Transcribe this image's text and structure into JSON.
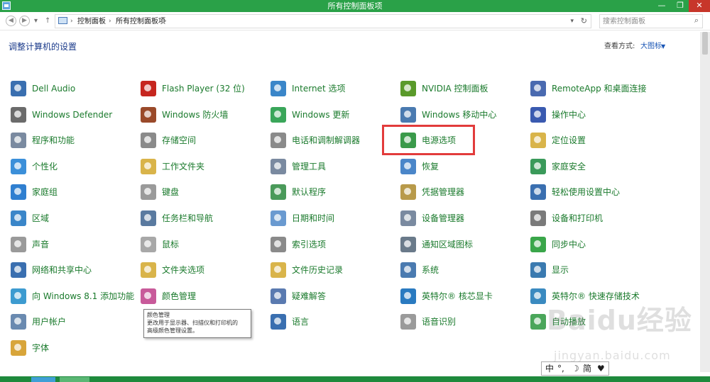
{
  "window": {
    "title": "所有控制面板项"
  },
  "nav": {
    "breadcrumb": [
      "控制面板",
      "所有控制面板项"
    ],
    "search_placeholder": "搜索控制面板"
  },
  "header": {
    "title": "调整计算机的设置",
    "view_by_label": "查看方式:",
    "view_by_value": "大图标"
  },
  "items": [
    {
      "label": "Dell Audio",
      "icon": "audio-icon",
      "color": "#3a6fb0"
    },
    {
      "label": "Windows Defender",
      "icon": "wall-icon",
      "color": "#6b6b6b"
    },
    {
      "label": "程序和功能",
      "icon": "programs-icon",
      "color": "#7a8aa0"
    },
    {
      "label": "个性化",
      "icon": "personalize-icon",
      "color": "#3b8fd9"
    },
    {
      "label": "家庭组",
      "icon": "homegroup-icon",
      "color": "#2f7fd0"
    },
    {
      "label": "区域",
      "icon": "globe-icon",
      "color": "#3a86c9"
    },
    {
      "label": "声音",
      "icon": "speaker-icon",
      "color": "#9a9a9a"
    },
    {
      "label": "网络和共享中心",
      "icon": "network-icon",
      "color": "#3a6fb0"
    },
    {
      "label": "向 Windows 8.1 添加功能",
      "icon": "add-features-icon",
      "color": "#3d9bd0"
    },
    {
      "label": "用户帐户",
      "icon": "users-icon",
      "color": "#6a8ab0"
    },
    {
      "label": "字体",
      "icon": "fonts-icon",
      "color": "#d8a53a"
    },
    {
      "label": "Flash Player (32 位)",
      "icon": "flash-icon",
      "color": "#c6261f"
    },
    {
      "label": "Windows 防火墙",
      "icon": "firewall-icon",
      "color": "#9a4a2a"
    },
    {
      "label": "存储空间",
      "icon": "storage-icon",
      "color": "#8a8a8a"
    },
    {
      "label": "工作文件夹",
      "icon": "work-folder-icon",
      "color": "#d9b44a"
    },
    {
      "label": "键盘",
      "icon": "keyboard-icon",
      "color": "#9a9a9a"
    },
    {
      "label": "任务栏和导航",
      "icon": "taskbar-icon",
      "color": "#5a7aa0"
    },
    {
      "label": "鼠标",
      "icon": "mouse-icon",
      "color": "#a8a8a8"
    },
    {
      "label": "文件夹选项",
      "icon": "folder-options-icon",
      "color": "#d9b44a"
    },
    {
      "label": "颜色管理",
      "icon": "color-icon",
      "color": "#c85a9a"
    },
    {
      "label": "Internet 选项",
      "icon": "internet-icon",
      "color": "#3a86c9"
    },
    {
      "label": "Windows 更新",
      "icon": "update-icon",
      "color": "#3aa65a"
    },
    {
      "label": "电话和调制解调器",
      "icon": "phone-icon",
      "color": "#8a8a8a"
    },
    {
      "label": "管理工具",
      "icon": "admin-tools-icon",
      "color": "#7a8aa0"
    },
    {
      "label": "默认程序",
      "icon": "default-programs-icon",
      "color": "#4a9a5a"
    },
    {
      "label": "日期和时间",
      "icon": "clock-icon",
      "color": "#6a9ad0"
    },
    {
      "label": "索引选项",
      "icon": "index-icon",
      "color": "#8a8a8a"
    },
    {
      "label": "文件历史记录",
      "icon": "file-history-icon",
      "color": "#d9b44a"
    },
    {
      "label": "疑难解答",
      "icon": "troubleshoot-icon",
      "color": "#5a7ab0"
    },
    {
      "label": "语言",
      "icon": "language-icon",
      "color": "#3a6fb0"
    },
    {
      "label": "NVIDIA 控制面板",
      "icon": "nvidia-icon",
      "color": "#5a9a2a"
    },
    {
      "label": "Windows 移动中心",
      "icon": "mobility-icon",
      "color": "#4a7ab0"
    },
    {
      "label": "电源选项",
      "icon": "power-icon",
      "color": "#3a9a4a"
    },
    {
      "label": "恢复",
      "icon": "recovery-icon",
      "color": "#4a86c9"
    },
    {
      "label": "凭据管理器",
      "icon": "credential-icon",
      "color": "#b89a4a"
    },
    {
      "label": "设备管理器",
      "icon": "device-manager-icon",
      "color": "#7a8aa0"
    },
    {
      "label": "通知区域图标",
      "icon": "notification-icon",
      "color": "#6a7a8a"
    },
    {
      "label": "系统",
      "icon": "system-icon",
      "color": "#4a7ab0"
    },
    {
      "label": "英特尔® 核芯显卡",
      "icon": "intel-graphics-icon",
      "color": "#2a7ac0"
    },
    {
      "label": "语音识别",
      "icon": "microphone-icon",
      "color": "#9a9a9a"
    },
    {
      "label": "RemoteApp 和桌面连接",
      "icon": "remoteapp-icon",
      "color": "#4a6ab0"
    },
    {
      "label": "操作中心",
      "icon": "flag-icon",
      "color": "#3a5ab0"
    },
    {
      "label": "定位设置",
      "icon": "location-icon",
      "color": "#d9b44a"
    },
    {
      "label": "家庭安全",
      "icon": "family-safety-icon",
      "color": "#3a9a5a"
    },
    {
      "label": "轻松使用设置中心",
      "icon": "ease-of-access-icon",
      "color": "#3a6fb0"
    },
    {
      "label": "设备和打印机",
      "icon": "printer-icon",
      "color": "#7a7a7a"
    },
    {
      "label": "同步中心",
      "icon": "sync-icon",
      "color": "#3aa64a"
    },
    {
      "label": "显示",
      "icon": "display-icon",
      "color": "#3a7ab0"
    },
    {
      "label": "英特尔® 快速存储技术",
      "icon": "intel-rst-icon",
      "color": "#3a8ac0"
    },
    {
      "label": "自动播放",
      "icon": "autoplay-icon",
      "color": "#4aa65a"
    }
  ],
  "tooltip": {
    "title": "颜色管理",
    "line1": "更改用于显示器、扫描仪和打印机的",
    "line2": "高级颜色管理设置。"
  },
  "ime": {
    "mode": "中",
    "punct": "°,",
    "moon": "☽",
    "simp": "简",
    "heart": "♥"
  },
  "watermark": {
    "text": "Baidu经验",
    "sub": "jingyan.baidu.com"
  }
}
